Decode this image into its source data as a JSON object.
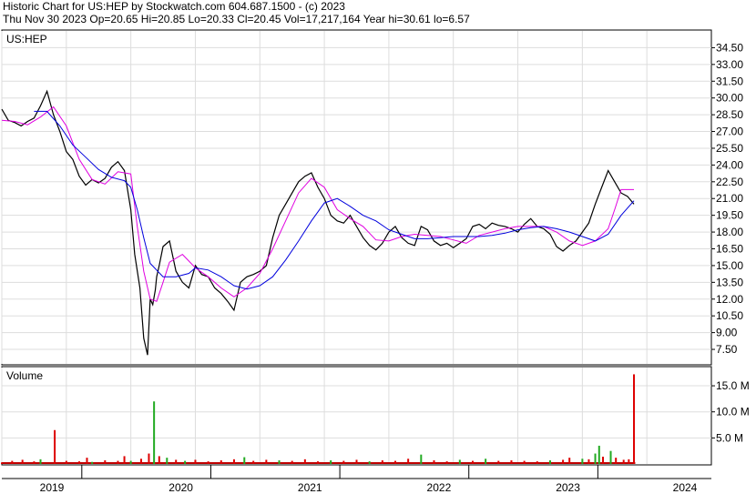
{
  "header": {
    "line1": "Historic Chart for US:HEP by Stockwatch.com 604.687.1500 - (c) 2023",
    "line2": "Thu Nov 30 2023  Op=20.65  Hi=20.85  Lo=20.33  Cl=20.45  Vol=17,217,164   Year hi=30.61  lo=6.57"
  },
  "chart_data": [
    {
      "type": "line",
      "name": "price",
      "title": "US:HEP",
      "ylim": [
        6.2,
        36.0
      ],
      "yticks": [
        "34.50",
        "33.00",
        "31.50",
        "30.00",
        "28.50",
        "27.00",
        "25.50",
        "24.00",
        "22.50",
        "21.00",
        "19.50",
        "18.00",
        "16.50",
        "15.00",
        "13.50",
        "12.00",
        "10.50",
        "9.00",
        "7.50"
      ],
      "xlim": [
        2019.0,
        2024.5
      ],
      "x_labels": [
        "2019",
        "2020",
        "2021",
        "2022",
        "2023",
        "2024"
      ],
      "grid": true,
      "series": [
        {
          "key": "close",
          "color": "#000000",
          "x": [
            2019.0,
            2019.05,
            2019.1,
            2019.15,
            2019.2,
            2019.25,
            2019.3,
            2019.35,
            2019.4,
            2019.45,
            2019.5,
            2019.55,
            2019.6,
            2019.65,
            2019.7,
            2019.75,
            2019.8,
            2019.85,
            2019.9,
            2019.95,
            2020.0,
            2020.03,
            2020.07,
            2020.1,
            2020.13,
            2020.15,
            2020.17,
            2020.19,
            2020.2,
            2020.22,
            2020.25,
            2020.3,
            2020.35,
            2020.4,
            2020.45,
            2020.5,
            2020.55,
            2020.6,
            2020.65,
            2020.7,
            2020.75,
            2020.8,
            2020.85,
            2020.9,
            2020.95,
            2021.0,
            2021.05,
            2021.1,
            2021.15,
            2021.2,
            2021.25,
            2021.3,
            2021.35,
            2021.4,
            2021.45,
            2021.5,
            2021.55,
            2021.6,
            2021.65,
            2021.7,
            2021.75,
            2021.8,
            2021.85,
            2021.9,
            2021.95,
            2022.0,
            2022.05,
            2022.1,
            2022.15,
            2022.2,
            2022.25,
            2022.3,
            2022.35,
            2022.4,
            2022.45,
            2022.5,
            2022.55,
            2022.6,
            2022.65,
            2022.7,
            2022.75,
            2022.8,
            2022.85,
            2022.9,
            2022.95,
            2023.0,
            2023.05,
            2023.1,
            2023.15,
            2023.2,
            2023.25,
            2023.3,
            2023.35,
            2023.4,
            2023.45,
            2023.5,
            2023.55,
            2023.6,
            2023.65,
            2023.7,
            2023.75,
            2023.8,
            2023.85,
            2023.9
          ],
          "y": [
            29.0,
            28.0,
            27.8,
            27.5,
            27.9,
            28.2,
            29.3,
            30.6,
            28.5,
            27.0,
            25.2,
            24.5,
            23.0,
            22.2,
            22.7,
            22.4,
            22.8,
            23.8,
            24.3,
            23.5,
            20.0,
            16.0,
            13.0,
            8.5,
            7.0,
            12.0,
            11.5,
            12.8,
            14.0,
            15.0,
            16.7,
            17.2,
            14.5,
            13.5,
            13.0,
            15.0,
            14.2,
            14.0,
            13.0,
            12.5,
            11.8,
            11.0,
            13.5,
            14.0,
            14.2,
            14.5,
            15.0,
            17.5,
            19.5,
            20.5,
            21.5,
            22.5,
            23.0,
            23.3,
            22.0,
            21.0,
            19.5,
            19.0,
            18.8,
            19.5,
            18.5,
            17.5,
            16.8,
            16.4,
            17.0,
            18.0,
            18.5,
            17.5,
            17.0,
            16.8,
            18.5,
            18.2,
            17.2,
            16.8,
            17.0,
            16.6,
            17.0,
            17.4,
            18.5,
            18.7,
            18.3,
            18.8,
            18.6,
            18.5,
            18.3,
            18.0,
            18.7,
            19.2,
            18.5,
            18.3,
            17.8,
            16.7,
            16.3,
            16.8,
            17.2,
            18.0,
            18.8,
            20.5,
            22.0,
            23.5,
            22.5,
            21.5,
            21.2,
            20.5
          ]
        },
        {
          "key": "ma_short",
          "color": "#e000e0",
          "x": [
            2019.0,
            2019.1,
            2019.2,
            2019.3,
            2019.4,
            2019.5,
            2019.6,
            2019.7,
            2019.8,
            2019.9,
            2020.0,
            2020.05,
            2020.1,
            2020.15,
            2020.2,
            2020.25,
            2020.3,
            2020.4,
            2020.5,
            2020.6,
            2020.7,
            2020.8,
            2020.9,
            2021.0,
            2021.1,
            2021.2,
            2021.3,
            2021.4,
            2021.5,
            2021.6,
            2021.7,
            2021.8,
            2021.9,
            2022.0,
            2022.1,
            2022.2,
            2022.3,
            2022.4,
            2022.5,
            2022.6,
            2022.7,
            2022.8,
            2022.9,
            2023.0,
            2023.1,
            2023.2,
            2023.3,
            2023.4,
            2023.5,
            2023.6,
            2023.7,
            2023.75,
            2023.8,
            2023.9
          ],
          "y": [
            28.0,
            27.9,
            27.6,
            28.3,
            29.2,
            27.5,
            24.5,
            22.7,
            22.3,
            23.4,
            23.2,
            18.5,
            14.5,
            12.0,
            11.8,
            13.5,
            15.3,
            16.0,
            14.8,
            14.0,
            13.0,
            12.2,
            13.0,
            14.3,
            16.5,
            19.0,
            21.5,
            22.8,
            22.0,
            20.0,
            19.2,
            18.5,
            17.3,
            17.2,
            17.6,
            17.8,
            17.7,
            17.6,
            17.3,
            17.0,
            17.7,
            18.0,
            18.3,
            18.5,
            18.5,
            18.5,
            18.0,
            17.2,
            16.8,
            17.2,
            18.3,
            20.0,
            21.8,
            21.8
          ]
        },
        {
          "key": "ma_long",
          "color": "#0000dd",
          "x": [
            2019.25,
            2019.35,
            2019.45,
            2019.55,
            2019.65,
            2019.75,
            2019.85,
            2019.95,
            2020.0,
            2020.05,
            2020.1,
            2020.15,
            2020.25,
            2020.35,
            2020.45,
            2020.5,
            2020.6,
            2020.7,
            2020.8,
            2020.9,
            2021.0,
            2021.1,
            2021.2,
            2021.3,
            2021.4,
            2021.5,
            2021.6,
            2021.7,
            2021.8,
            2021.9,
            2022.0,
            2022.1,
            2022.2,
            2022.3,
            2022.4,
            2022.5,
            2022.6,
            2022.7,
            2022.8,
            2022.9,
            2023.0,
            2023.1,
            2023.2,
            2023.3,
            2023.4,
            2023.5,
            2023.6,
            2023.7,
            2023.8,
            2023.9
          ],
          "y": [
            28.8,
            28.8,
            27.5,
            25.8,
            24.7,
            23.6,
            22.9,
            22.6,
            22.0,
            20.0,
            17.5,
            15.2,
            14.0,
            14.0,
            14.3,
            14.8,
            14.6,
            14.0,
            13.2,
            12.9,
            13.2,
            14.0,
            15.5,
            17.2,
            19.0,
            20.6,
            21.0,
            20.3,
            19.5,
            19.0,
            18.2,
            17.8,
            17.4,
            17.4,
            17.5,
            17.6,
            17.6,
            17.6,
            17.7,
            17.9,
            18.2,
            18.4,
            18.5,
            18.3,
            18.0,
            17.6,
            17.2,
            17.8,
            19.5,
            20.8
          ]
        }
      ]
    },
    {
      "type": "bar",
      "name": "volume",
      "title": "Volume",
      "ylim": [
        0,
        18.5
      ],
      "yticks": [
        "15.0 M",
        "10.0 M",
        "5.0 M"
      ],
      "bars": [
        {
          "x": 2019.0,
          "v": 0.3,
          "c": "red"
        },
        {
          "x": 2019.08,
          "v": 0.6,
          "c": "red"
        },
        {
          "x": 2019.16,
          "v": 0.8,
          "c": "red"
        },
        {
          "x": 2019.25,
          "v": 0.5,
          "c": "red"
        },
        {
          "x": 2019.3,
          "v": 0.9,
          "c": "green"
        },
        {
          "x": 2019.41,
          "v": 6.5,
          "c": "red"
        },
        {
          "x": 2019.5,
          "v": 0.6,
          "c": "red"
        },
        {
          "x": 2019.6,
          "v": 0.5,
          "c": "red"
        },
        {
          "x": 2019.66,
          "v": 1.2,
          "c": "red"
        },
        {
          "x": 2019.7,
          "v": 0.4,
          "c": "green"
        },
        {
          "x": 2019.8,
          "v": 0.7,
          "c": "red"
        },
        {
          "x": 2019.9,
          "v": 0.6,
          "c": "red"
        },
        {
          "x": 2019.95,
          "v": 1.5,
          "c": "red"
        },
        {
          "x": 2020.0,
          "v": 0.6,
          "c": "green"
        },
        {
          "x": 2020.08,
          "v": 1.0,
          "c": "red"
        },
        {
          "x": 2020.14,
          "v": 2.0,
          "c": "red"
        },
        {
          "x": 2020.18,
          "v": 12.0,
          "c": "green"
        },
        {
          "x": 2020.22,
          "v": 1.5,
          "c": "red"
        },
        {
          "x": 2020.28,
          "v": 1.2,
          "c": "green"
        },
        {
          "x": 2020.35,
          "v": 0.8,
          "c": "red"
        },
        {
          "x": 2020.42,
          "v": 0.6,
          "c": "green"
        },
        {
          "x": 2020.5,
          "v": 0.8,
          "c": "red"
        },
        {
          "x": 2020.6,
          "v": 0.5,
          "c": "red"
        },
        {
          "x": 2020.7,
          "v": 0.7,
          "c": "red"
        },
        {
          "x": 2020.8,
          "v": 0.9,
          "c": "red"
        },
        {
          "x": 2020.88,
          "v": 1.3,
          "c": "green"
        },
        {
          "x": 2020.95,
          "v": 0.6,
          "c": "red"
        },
        {
          "x": 2021.05,
          "v": 0.8,
          "c": "red"
        },
        {
          "x": 2021.15,
          "v": 0.7,
          "c": "green"
        },
        {
          "x": 2021.25,
          "v": 0.6,
          "c": "red"
        },
        {
          "x": 2021.35,
          "v": 0.9,
          "c": "red"
        },
        {
          "x": 2021.45,
          "v": 0.5,
          "c": "red"
        },
        {
          "x": 2021.55,
          "v": 0.7,
          "c": "green"
        },
        {
          "x": 2021.65,
          "v": 0.6,
          "c": "red"
        },
        {
          "x": 2021.75,
          "v": 0.8,
          "c": "red"
        },
        {
          "x": 2021.85,
          "v": 0.5,
          "c": "green"
        },
        {
          "x": 2021.95,
          "v": 0.7,
          "c": "red"
        },
        {
          "x": 2022.05,
          "v": 0.6,
          "c": "red"
        },
        {
          "x": 2022.15,
          "v": 1.0,
          "c": "red"
        },
        {
          "x": 2022.25,
          "v": 1.8,
          "c": "green"
        },
        {
          "x": 2022.35,
          "v": 0.7,
          "c": "red"
        },
        {
          "x": 2022.45,
          "v": 0.5,
          "c": "red"
        },
        {
          "x": 2022.55,
          "v": 0.8,
          "c": "green"
        },
        {
          "x": 2022.65,
          "v": 0.6,
          "c": "red"
        },
        {
          "x": 2022.75,
          "v": 1.0,
          "c": "green"
        },
        {
          "x": 2022.85,
          "v": 0.6,
          "c": "red"
        },
        {
          "x": 2022.95,
          "v": 0.7,
          "c": "red"
        },
        {
          "x": 2023.05,
          "v": 0.6,
          "c": "red"
        },
        {
          "x": 2023.15,
          "v": 0.5,
          "c": "red"
        },
        {
          "x": 2023.25,
          "v": 0.7,
          "c": "green"
        },
        {
          "x": 2023.35,
          "v": 0.8,
          "c": "red"
        },
        {
          "x": 2023.4,
          "v": 1.2,
          "c": "red"
        },
        {
          "x": 2023.5,
          "v": 1.0,
          "c": "green"
        },
        {
          "x": 2023.55,
          "v": 0.9,
          "c": "red"
        },
        {
          "x": 2023.6,
          "v": 2.0,
          "c": "green"
        },
        {
          "x": 2023.63,
          "v": 3.5,
          "c": "green"
        },
        {
          "x": 2023.66,
          "v": 1.4,
          "c": "red"
        },
        {
          "x": 2023.72,
          "v": 2.5,
          "c": "green"
        },
        {
          "x": 2023.76,
          "v": 1.2,
          "c": "red"
        },
        {
          "x": 2023.82,
          "v": 0.8,
          "c": "red"
        },
        {
          "x": 2023.86,
          "v": 0.9,
          "c": "red"
        },
        {
          "x": 2023.9,
          "v": 17.2,
          "c": "red"
        }
      ]
    }
  ]
}
